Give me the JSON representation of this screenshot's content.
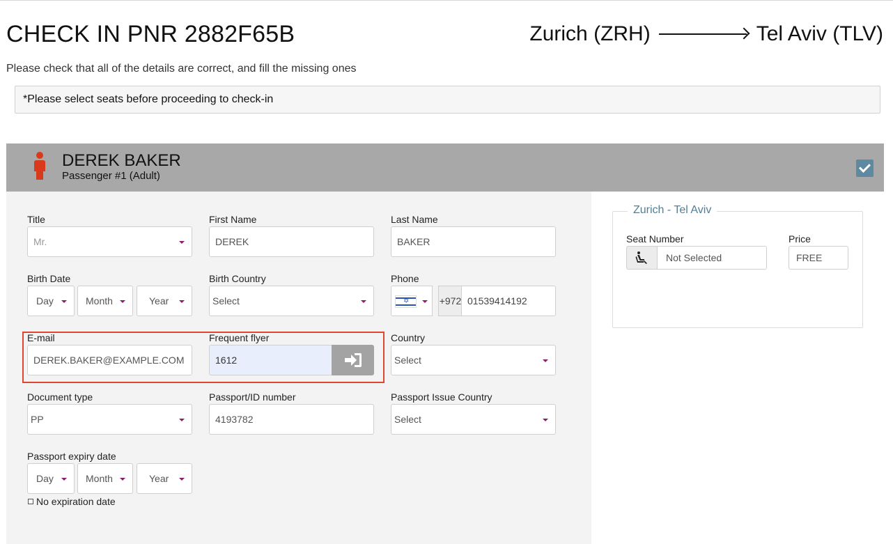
{
  "header": {
    "title": "CHECK IN PNR 2882F65B",
    "origin": "Zurich (ZRH)",
    "destination": "Tel Aviv (TLV)",
    "subtitle": "Please check that all of the details are correct, and fill the missing ones",
    "notice": "*Please select seats before proceeding to check-in"
  },
  "passenger": {
    "name": "DEREK BAKER",
    "type": "Passenger #1 (Adult)",
    "icon_color": "#d93a1c",
    "check_color": "#5d8aa0"
  },
  "form": {
    "title_label": "Title",
    "title_value": "Mr.",
    "first_name_label": "First Name",
    "first_name_value": "DEREK",
    "last_name_label": "Last Name",
    "last_name_value": "BAKER",
    "birth_date_label": "Birth Date",
    "birth_day": "Day",
    "birth_month": "Month",
    "birth_year": "Year",
    "birth_country_label": "Birth Country",
    "birth_country_value": "Select",
    "phone_label": "Phone",
    "phone_dial": "+972",
    "phone_value": "01539414192",
    "email_label": "E-mail",
    "email_value": "DEREK.BAKER@EXAMPLE.COM",
    "ff_label": "Frequent flyer",
    "ff_value": "1612",
    "country_label": "Country",
    "country_value": "Select",
    "doc_type_label": "Document type",
    "doc_type_value": "PP",
    "passport_label": "Passport/ID number",
    "passport_value": "4193782",
    "issue_country_label": "Passport Issue Country",
    "issue_country_value": "Select",
    "expiry_label": "Passport expiry date",
    "expiry_day": "Day",
    "expiry_month": "Month",
    "expiry_year": "Year",
    "no_expiry_label": "No expiration date"
  },
  "seats": {
    "segment": "Zurich - Tel Aviv",
    "seat_label": "Seat Number",
    "seat_value": "Not Selected",
    "price_label": "Price",
    "price_value": "FREE"
  },
  "colors": {
    "highlight": "#e2452f",
    "caret": "#8b1d6b",
    "header_bar": "#a8a8a8",
    "legend": "#4f7f97"
  },
  "icons": {
    "person": "person-icon",
    "check": "checkmark-icon",
    "login": "sign-in-icon",
    "seat": "seat-icon",
    "flag": "israel-flag-icon"
  }
}
